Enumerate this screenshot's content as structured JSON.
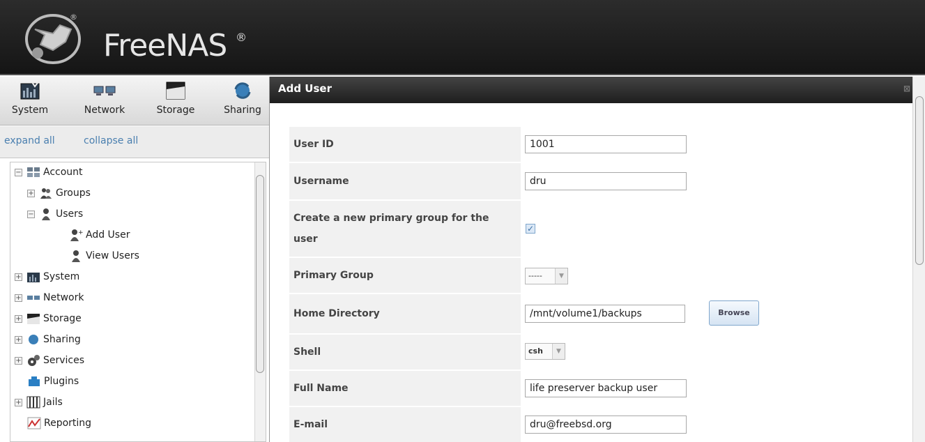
{
  "header": {
    "brand": "FreeNAS",
    "reg": "®"
  },
  "topnav": [
    {
      "label": "System",
      "icon": "system-icon"
    },
    {
      "label": "Network",
      "icon": "network-icon"
    },
    {
      "label": "Storage",
      "icon": "storage-icon"
    },
    {
      "label": "Sharing",
      "icon": "sharing-icon"
    }
  ],
  "tree_controls": {
    "expand": "expand all",
    "collapse": "collapse all"
  },
  "tree": {
    "account": "Account",
    "groups": "Groups",
    "users": "Users",
    "add_user": "Add User",
    "view_users": "View Users",
    "system": "System",
    "network": "Network",
    "storage": "Storage",
    "sharing": "Sharing",
    "services": "Services",
    "plugins": "Plugins",
    "jails": "Jails",
    "reporting": "Reporting"
  },
  "dialog": {
    "title": "Add User",
    "close": "⊠",
    "fields": {
      "user_id": {
        "label": "User ID",
        "value": "1001"
      },
      "username": {
        "label": "Username",
        "value": "dru"
      },
      "create_group": {
        "label": "Create a new primary group for the user",
        "checked": true
      },
      "primary_group": {
        "label": "Primary Group",
        "value": "-----"
      },
      "home_dir": {
        "label": "Home Directory",
        "value": "/mnt/volume1/backups",
        "button": "Browse"
      },
      "shell": {
        "label": "Shell",
        "value": "csh"
      },
      "full_name": {
        "label": "Full Name",
        "value": "life preserver backup user"
      },
      "email": {
        "label": "E-mail",
        "value": "dru@freebsd.org"
      }
    }
  },
  "colors": {
    "header_bg": "#1e1e1e",
    "link": "#4a7faf",
    "label_bg": "#f1f1f1"
  }
}
